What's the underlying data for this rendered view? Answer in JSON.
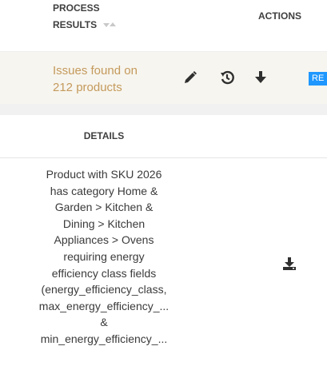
{
  "header": {
    "process_results_line1": "PROCESS",
    "process_results_line2": "RESULTS",
    "actions": "ACTIONS",
    "sort_icon": "sort-arrows-icon"
  },
  "result_row": {
    "issues_line1": "Issues found on",
    "issues_line2": "212 products",
    "icons": [
      "pencil-icon",
      "history-icon",
      "download-arrow-icon"
    ],
    "badge": "RE",
    "colors": {
      "issues_text": "#c49a5c",
      "row_bg": "#f7f5ef",
      "badge_bg": "#1f97ff"
    }
  },
  "details": {
    "title": "DETAILS",
    "lines": [
      "Product with SKU 2026",
      "has category Home &",
      "Garden > Kitchen &",
      "Dining > Kitchen",
      "Appliances > Ovens",
      "requiring energy",
      "efficiency class fields",
      "(energy_efficiency_class,",
      "max_energy_efficiency_...",
      "&",
      "min_energy_efficiency_..."
    ],
    "icon": "download-tray-icon"
  }
}
